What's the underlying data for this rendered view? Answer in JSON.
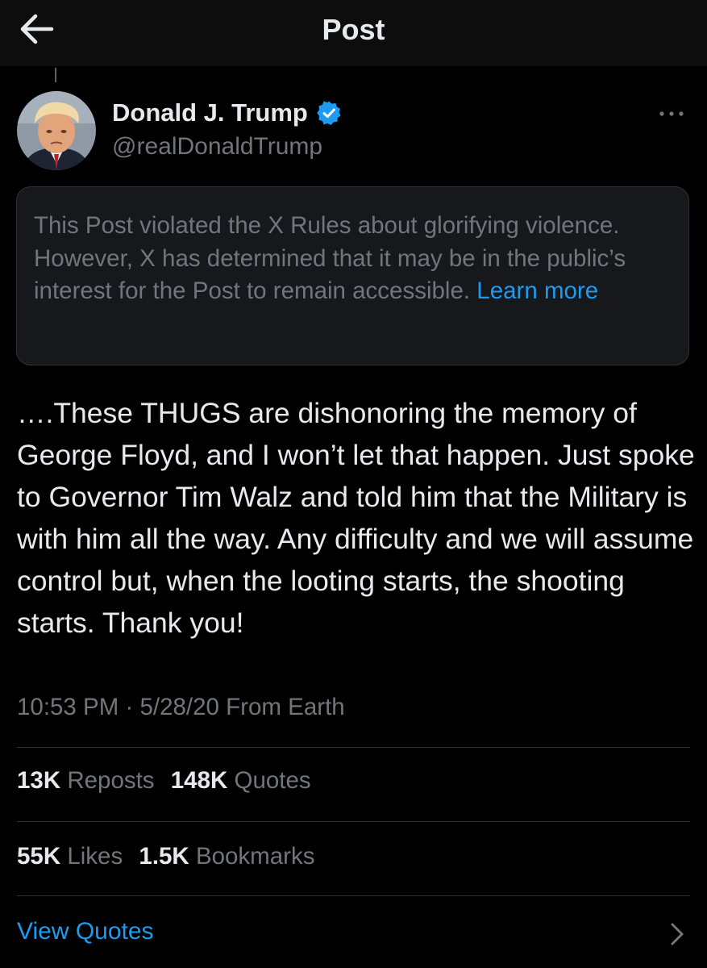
{
  "header": {
    "title": "Post",
    "back_icon": "arrow-left-icon"
  },
  "author": {
    "name": "Donald J. Trump",
    "handle": "@realDonaldTrump",
    "verified": true,
    "verified_icon": "verified-badge-icon",
    "avatar_icon": "avatar-portrait",
    "more_icon": "more-options-icon"
  },
  "notice": {
    "text": "This Post violated the X Rules about glorifying violence. However, X has determined that it may be in the public’s interest for the Post to remain accessible.",
    "link_label": "Learn more"
  },
  "post": {
    "text": "….These THUGS are dishonoring the memory of George Floyd, and I won’t let that happen. Just spoke to Governor Tim Walz and told him that the Military is with him all the way. Any difficulty and we will assume control but, when the looting starts, the shooting starts. Thank you!"
  },
  "meta": {
    "time": "10:53 PM",
    "separator": "·",
    "date": "5/28/20",
    "source": "From Earth"
  },
  "stats_row1": [
    {
      "count": "13K",
      "label": "Reposts"
    },
    {
      "count": "148K",
      "label": "Quotes"
    }
  ],
  "stats_row2": [
    {
      "count": "55K",
      "label": "Likes"
    },
    {
      "count": "1.5K",
      "label": "Bookmarks"
    }
  ],
  "view_quotes": {
    "label": "View Quotes",
    "icon": "chevron-right-icon"
  },
  "colors": {
    "background": "#000000",
    "accent": "#1d9bf0",
    "muted": "#71767b",
    "text": "#e7e9ea",
    "border": "#2f3336"
  }
}
